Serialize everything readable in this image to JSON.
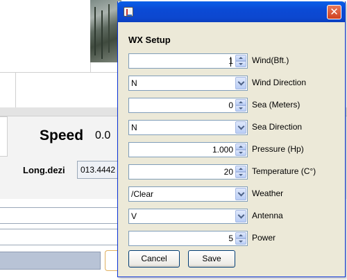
{
  "background_app": {
    "speed_label": "Speed",
    "speed_value": "0.0",
    "longitude_label": "Long.dezi",
    "longitude_value": "013.4442"
  },
  "dialog": {
    "section_title": "WX Setup",
    "close_glyph": "✕",
    "icons": [
      "java-app-icon",
      "close-icon",
      "spin-up-icon",
      "spin-down-icon",
      "dropdown-arrow-icon"
    ],
    "fields": [
      {
        "kind": "spinner",
        "value": "1",
        "label": "Wind(Bft.)"
      },
      {
        "kind": "combo",
        "value": "N",
        "label": "Wind Direction"
      },
      {
        "kind": "spinner",
        "value": "0",
        "label": "Sea (Meters)"
      },
      {
        "kind": "combo",
        "value": "N",
        "label": "Sea Direction"
      },
      {
        "kind": "spinner",
        "value": "1.000",
        "label": "Pressure (Hp)"
      },
      {
        "kind": "spinner",
        "value": "20",
        "label": "Temperature (C°)"
      },
      {
        "kind": "combo",
        "value": "/Clear",
        "label": "Weather"
      },
      {
        "kind": "combo",
        "value": "V",
        "label": "Antenna"
      },
      {
        "kind": "spinner",
        "value": "5",
        "label": "Power"
      }
    ],
    "buttons": {
      "cancel": "Cancel",
      "save": "Save"
    }
  },
  "colors": {
    "titlebar": "#0b4ad5",
    "dialog_bg": "#ece9d8",
    "close_button": "#d0401f"
  }
}
